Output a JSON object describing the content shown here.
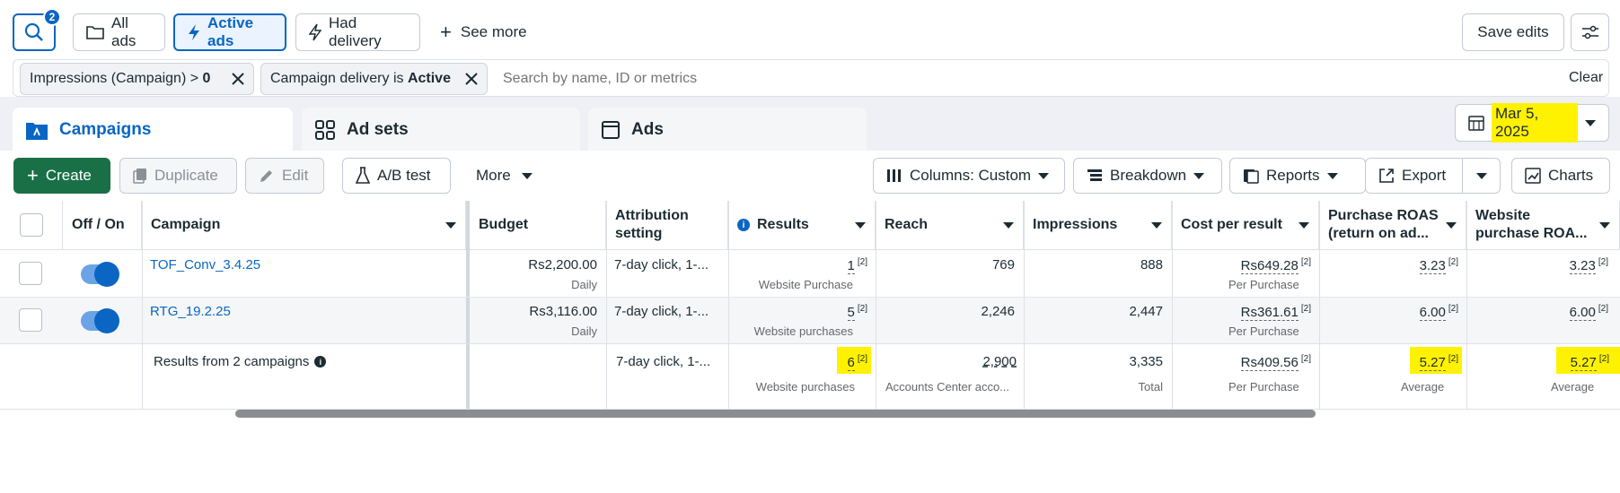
{
  "toolbar": {
    "search_badge": "2",
    "all_ads": "All ads",
    "active_ads": "Active ads",
    "had_delivery": "Had delivery",
    "see_more": "See more",
    "save_edits": "Save edits"
  },
  "filters": {
    "chip1_text": "Impressions (Campaign) > ",
    "chip1_value": "0",
    "chip2_text": "Campaign delivery is ",
    "chip2_value": "Active",
    "search_placeholder": "Search by name, ID or metrics",
    "clear": "Clear"
  },
  "tabs": {
    "campaigns": "Campaigns",
    "ad_sets": "Ad sets",
    "ads": "Ads"
  },
  "date": "Mar 5, 2025",
  "actions": {
    "create": "Create",
    "duplicate": "Duplicate",
    "edit": "Edit",
    "ab_test": "A/B test",
    "more": "More",
    "columns": "Columns: Custom",
    "breakdown": "Breakdown",
    "reports": "Reports",
    "export": "Export",
    "charts": "Charts"
  },
  "columns": {
    "off_on": "Off / On",
    "campaign": "Campaign",
    "budget": "Budget",
    "attribution": "Attribution setting",
    "results": "Results",
    "reach": "Reach",
    "impressions": "Impressions",
    "cost_per_result": "Cost per result",
    "purchase_roas": "Purchase ROAS (return on ad...",
    "website_roas": "Website purchase ROA..."
  },
  "rows": [
    {
      "name": "TOF_Conv_3.4.25",
      "budget": "Rs2,200.00",
      "budget_sub": "Daily",
      "attribution": "7-day click, 1-...",
      "results": "1",
      "results_sub": "Website Purchase",
      "reach": "769",
      "impressions": "888",
      "cpr": "Rs649.28",
      "cpr_sub": "Per Purchase",
      "roas": "3.23",
      "web_roas": "3.23"
    },
    {
      "name": "RTG_19.2.25",
      "budget": "Rs3,116.00",
      "budget_sub": "Daily",
      "attribution": "7-day click, 1-...",
      "results": "5",
      "results_sub": "Website purchases",
      "reach": "2,246",
      "impressions": "2,447",
      "cpr": "Rs361.61",
      "cpr_sub": "Per Purchase",
      "roas": "6.00",
      "web_roas": "6.00"
    }
  ],
  "summary": {
    "label": "Results from 2 campaigns",
    "attribution": "7-day click, 1-...",
    "results": "6",
    "results_sub": "Website purchases",
    "reach": "2,900",
    "reach_sub": "Accounts Center acco...",
    "impressions": "3,335",
    "impressions_sub": "Total",
    "cpr": "Rs409.56",
    "cpr_sub": "Per Purchase",
    "roas": "5.27",
    "roas_sub": "Average",
    "web_roas": "5.27",
    "web_roas_sub": "Average"
  },
  "footnote_mark": "[2]"
}
